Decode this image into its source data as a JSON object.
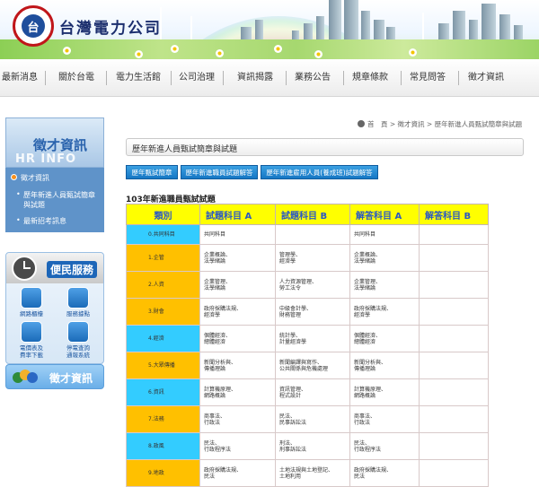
{
  "header": {
    "company_name": "台灣電力公司",
    "logo_glyph": "台"
  },
  "nav": {
    "items": [
      "最新消息",
      "關於台電",
      "電力生活館",
      "公司治理",
      "資訊揭露",
      "業務公告",
      "規章條款",
      "常見問答",
      "徵才資訊"
    ]
  },
  "sidebar": {
    "title": "徵才資訊",
    "title_en": "HR INFO",
    "items": [
      {
        "label_line1": "徵才資訊",
        "label_line2": ""
      },
      {
        "label_line1": "歷年新進人員甄試簡章",
        "label_line2": "與試題"
      },
      {
        "label_line1": "最新招考訊息",
        "label_line2": ""
      }
    ],
    "service": {
      "title": "便民服務",
      "items": [
        {
          "label": "網路櫃檯"
        },
        {
          "label": "服務據點"
        },
        {
          "label": "電價表及\n費率下載"
        },
        {
          "label": "停電查詢\n通報系統"
        }
      ]
    },
    "hr_banner": "徵才資訊"
  },
  "breadcrumb": {
    "text": "首　頁 > 徵才資訊 > 歷年新進人員甄試簡章與試題"
  },
  "page": {
    "title": "歷年新進人員甄試簡章與試題",
    "tabs": [
      "歷年甄試簡章",
      "歷年新進職員試題解答",
      "歷年新進雇用人員(養成班)試題解答"
    ],
    "section_title": "103年新進職員甄試試題"
  },
  "table": {
    "headers": [
      "類別",
      "試題科目 A",
      "試題科目 B",
      "解答科目 A",
      "解答科目 B"
    ],
    "rows": [
      {
        "category": "0.共同科目",
        "a": "共同科目",
        "b": "",
        "ans_a": "共同科目",
        "ans_b": ""
      },
      {
        "category": "1.企管",
        "a": "企業概論、\n法學緒論",
        "b": "管理學、\n經濟學",
        "ans_a": "企業概論、\n法學緒論",
        "ans_b": ""
      },
      {
        "category": "2.人資",
        "a": "企業管理、\n法學緒論",
        "b": "人力資源管理、\n勞工法令",
        "ans_a": "企業管理、\n法學緒論",
        "ans_b": ""
      },
      {
        "category": "3.財會",
        "a": "政府採購法規、\n經濟學",
        "b": "中級會計學、\n財務管理",
        "ans_a": "政府採購法規、\n經濟學",
        "ans_b": ""
      },
      {
        "category": "4.經濟",
        "a": "個體經濟、\n總體經濟",
        "b": "統計學、\n計量經濟學",
        "ans_a": "個體經濟、\n總體經濟",
        "ans_b": ""
      },
      {
        "category": "5.大眾傳播",
        "a": "新聞分析與、\n傳播理論",
        "b": "新聞編譯與寫作、\n公共關係與危機處理",
        "ans_a": "新聞分析與、\n傳播理論",
        "ans_b": ""
      },
      {
        "category": "6.資訊",
        "a": "計算機原理、\n網路概論",
        "b": "資訊管理、\n程式設計",
        "ans_a": "計算機原理、\n網路概論",
        "ans_b": ""
      },
      {
        "category": "7.法務",
        "a": "商事法、\n行政法",
        "b": "民法、\n民事訴訟法",
        "ans_a": "商事法、\n行政法",
        "ans_b": ""
      },
      {
        "category": "8.政風",
        "a": "民法、\n行政程序法",
        "b": "刑法、\n刑事訴訟法",
        "ans_a": "民法、\n行政程序法",
        "ans_b": ""
      },
      {
        "category": "9.地政",
        "a": "政府採購法規、\n民法",
        "b": "土地法規與土地登記、\n土地利用",
        "ans_a": "政府採購法規、\n民法",
        "ans_b": ""
      }
    ]
  },
  "colors": {
    "header_yellow": "#ffff00",
    "header_text_blue": "#2b59c3",
    "cat_orange": "#ffc000",
    "cat_cyan": "#33ccff",
    "tab_blue": "#1677c4",
    "side_blue": "#5f93c9"
  }
}
